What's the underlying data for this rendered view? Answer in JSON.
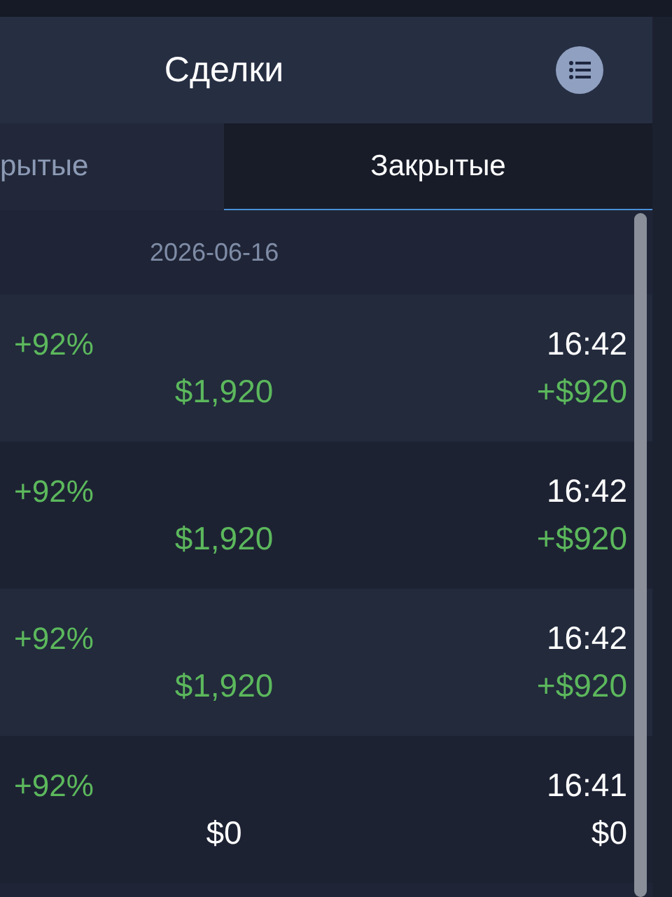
{
  "header": {
    "title": "Сделки"
  },
  "tabs": [
    {
      "label": "рытые",
      "selected": false
    },
    {
      "label": "Закрытые",
      "selected": true
    }
  ],
  "date": "2026-06-16",
  "trades": [
    {
      "payout": "+92%",
      "time": "16:42",
      "amount": "$1,920",
      "profit": "+$920",
      "kind": "win"
    },
    {
      "payout": "+92%",
      "time": "16:42",
      "amount": "$1,920",
      "profit": "+$920",
      "kind": "win"
    },
    {
      "payout": "+92%",
      "time": "16:42",
      "amount": "$1,920",
      "profit": "+$920",
      "kind": "win"
    },
    {
      "payout": "+92%",
      "time": "16:41",
      "amount": "$0",
      "profit": "$0",
      "kind": "even"
    }
  ]
}
